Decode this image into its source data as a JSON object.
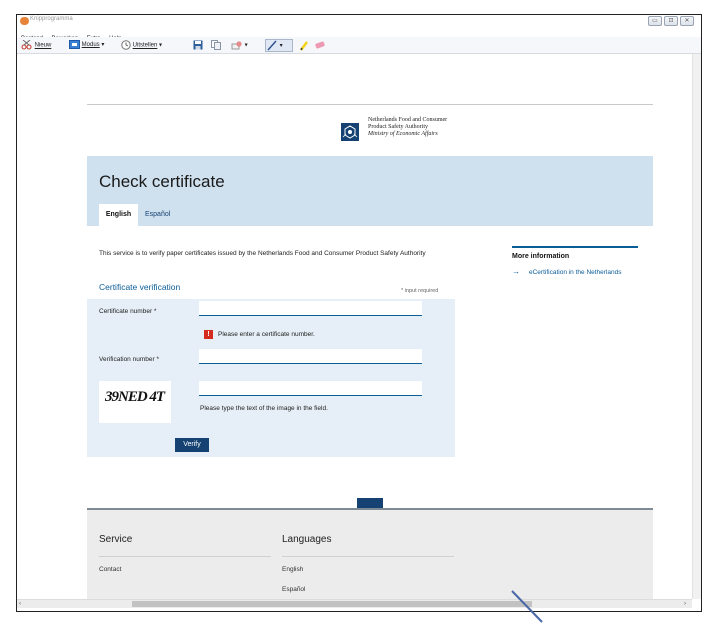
{
  "window": {
    "title": "Knipprogramma",
    "controls": [
      "▭",
      "⊡",
      "✕"
    ]
  },
  "menubar": [
    "Bestand",
    "Bewerken",
    "Extra",
    "Help"
  ],
  "toolbar": {
    "new_label": "Nieuw",
    "mode_label": "Modus",
    "delay_label": "Uitstellen"
  },
  "header": {
    "org_line1": "Netherlands Food and Consumer",
    "org_line2": "Product Safety Authority",
    "org_line3": "Ministry of Economic Affairs"
  },
  "banner": {
    "title": "Check certificate",
    "tabs": [
      "English",
      "Español"
    ]
  },
  "intro": "This service is to verify paper certificates issued by the Netherlands Food and Consumer Product Safety Authority",
  "form": {
    "section_title": "Certificate verification",
    "required_note": "* input required",
    "certificate_label": "Certificate number *",
    "certificate_value": "",
    "error_message": "Please enter a certificate number.",
    "verification_label": "Verification number *",
    "verification_value": "",
    "captcha_text": "39NED 4T",
    "captcha_value": "",
    "captcha_hint": "Please type the text of the image in the field.",
    "verify_label": "Verify"
  },
  "sidebar": {
    "title": "More information",
    "link": "eCertification in the Netherlands"
  },
  "footer": {
    "service_title": "Service",
    "service_links": [
      "Contact"
    ],
    "languages_title": "Languages",
    "language_links": [
      "English",
      "Español"
    ]
  },
  "colors": {
    "brand_dark_blue": "#154273",
    "link_blue": "#0b5d98",
    "banner_blue": "#cfe0ee",
    "form_blue": "#e6eff7",
    "error_red": "#d52b1e",
    "footer_gray": "#ececec"
  },
  "icons": [
    "app-icon",
    "scissors-new-icon",
    "mode-icon",
    "clock-delay-icon",
    "save-icon",
    "copy-icon",
    "send-icon",
    "pen-icon",
    "highlighter-icon",
    "eraser-icon",
    "crest-icon",
    "error-icon",
    "arrow-right-icon"
  ]
}
